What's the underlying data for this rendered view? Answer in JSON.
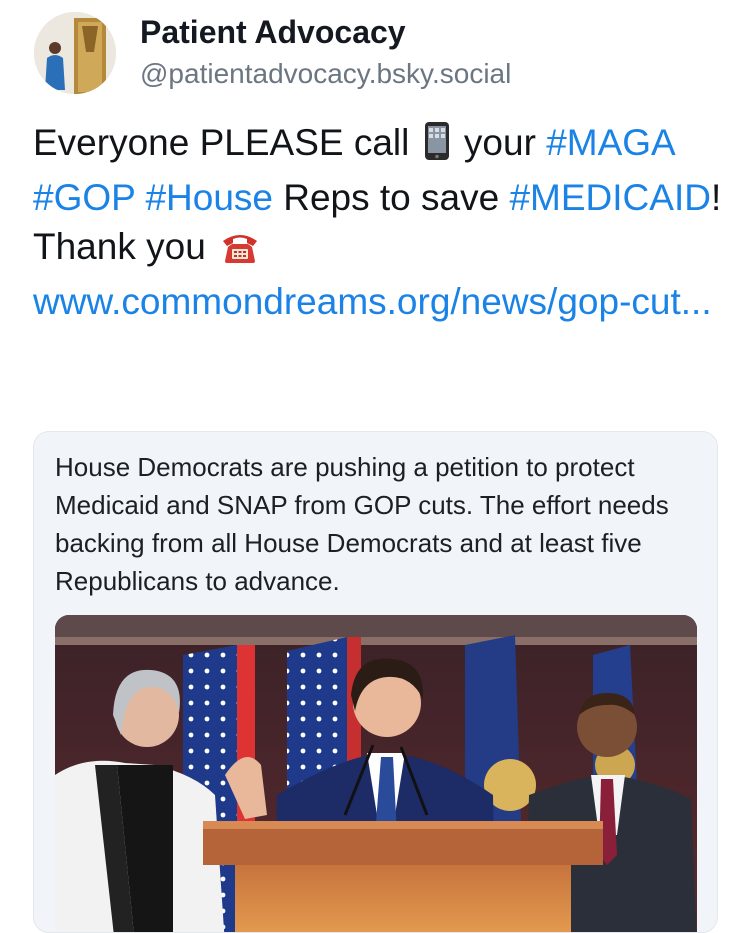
{
  "author": {
    "display_name": "Patient Advocacy",
    "handle": "@patientadvocacy.bsky.social",
    "avatar_icon": "avatar-photo"
  },
  "post": {
    "t1": "Everyone PLEASE call ",
    "t2": " your ",
    "tag_maga": "#MAGA",
    "tag_gop": "#GOP",
    "tag_house": "#House",
    "t3": " Reps to save ",
    "tag_medicaid": "#MEDICAID",
    "t4": "! Thank you ",
    "link": "www.commondreams.org/news/gop-cut...",
    "emoji_1": "mobile-phone-icon",
    "emoji_2": "telephone-icon"
  },
  "embed": {
    "description": "House Democrats are pushing a petition to protect Medicaid and SNAP from GOP cuts. The effort needs backing from all House Democrats and at least five Republicans to advance.",
    "image_icon": "press-conference-photo"
  },
  "colors": {
    "link": "#1a83e5",
    "text": "#111418",
    "handle": "#6b7682",
    "card_bg": "#f1f4f8"
  }
}
